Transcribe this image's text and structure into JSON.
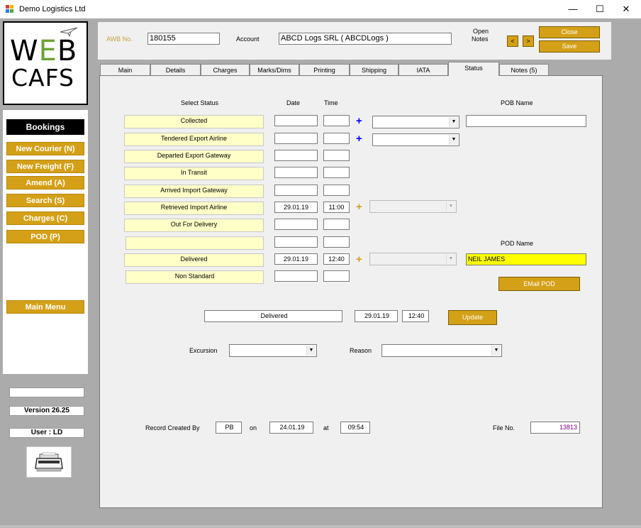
{
  "window": {
    "title": "Demo Logistics Ltd",
    "minimize": "—",
    "maximize": "☐",
    "close": "✕"
  },
  "logo": {
    "line1": "WEB",
    "line2": "CAFS"
  },
  "sidebar": {
    "heading": "Bookings",
    "buttons": [
      "New Courier (N)",
      "New Freight (F)",
      "Amend (A)",
      "Search (S)",
      "Charges (C)",
      "POD (P)"
    ],
    "main_menu": "Main Menu",
    "blank": "",
    "version": "Version 26.25",
    "user": "User : LD"
  },
  "header": {
    "awb_label": "AWB No.",
    "awb_value": "180155",
    "account_label": "Account",
    "account_value": "ABCD Logs SRL   ( ABCDLogs )",
    "open_notes_label_1": "Open",
    "open_notes_label_2": "Notes",
    "prev": "<",
    "next": ">",
    "close_button": "Close",
    "save_button": "Save"
  },
  "tabs": [
    "Main",
    "Details",
    "Charges",
    "Marks/Dims",
    "Printing",
    "Shipping",
    "IATA",
    "Status",
    "Notes (5)"
  ],
  "active_tab": "Status",
  "status": {
    "col_select_status": "Select Status",
    "col_date": "Date",
    "col_time": "Time",
    "col_pob_name": "POB Name",
    "col_pod_name": "POD Name",
    "rows": [
      {
        "label": "Collected",
        "date": "",
        "time": ""
      },
      {
        "label": "Tendered Export Airline",
        "date": "",
        "time": ""
      },
      {
        "label": "Departed Export Gateway",
        "date": "",
        "time": ""
      },
      {
        "label": "In Transit",
        "date": "",
        "time": ""
      },
      {
        "label": "Arrived Import Gateway",
        "date": "",
        "time": ""
      },
      {
        "label": "Retrieved Import Airline",
        "date": "29.01.19",
        "time": "11:00"
      },
      {
        "label": "Out For Delivery",
        "date": "",
        "time": ""
      },
      {
        "label": "",
        "date": "",
        "time": ""
      },
      {
        "label": "Delivered",
        "date": "29.01.19",
        "time": "12:40"
      },
      {
        "label": "Non Standard",
        "date": "",
        "time": ""
      }
    ],
    "plus_symbol": "+",
    "pob_name_value": "",
    "pod_name_value": "NEIL JAMES",
    "email_pod_button": "EMail POD",
    "current_status": "Delivered",
    "current_date": "29.01.19",
    "current_time": "12:40",
    "update_button": "Update",
    "excursion_label": "Excursion",
    "excursion_value": "",
    "reason_label": "Reason",
    "reason_value": "",
    "record_created_by_label": "Record Created By",
    "created_by": "PB",
    "on_label": "on",
    "created_date": "24.01.19",
    "at_label": "at",
    "created_time": "09:54",
    "file_no_label": "File No.",
    "file_no": "13813"
  },
  "colors": {
    "gold": "#d4a017",
    "status_label_bg": "#ffffc8",
    "pod_highlight": "#ffff00",
    "plus_blue": "#0000ff",
    "plus_gold": "#d4a017",
    "file_no_color": "#800080",
    "awb_label_color": "#c8a040"
  },
  "icons": {
    "app": "app-window-icon",
    "plane": "paper-plane-icon",
    "printer": "printer-icon",
    "dropdown": "chevron-down-icon"
  }
}
